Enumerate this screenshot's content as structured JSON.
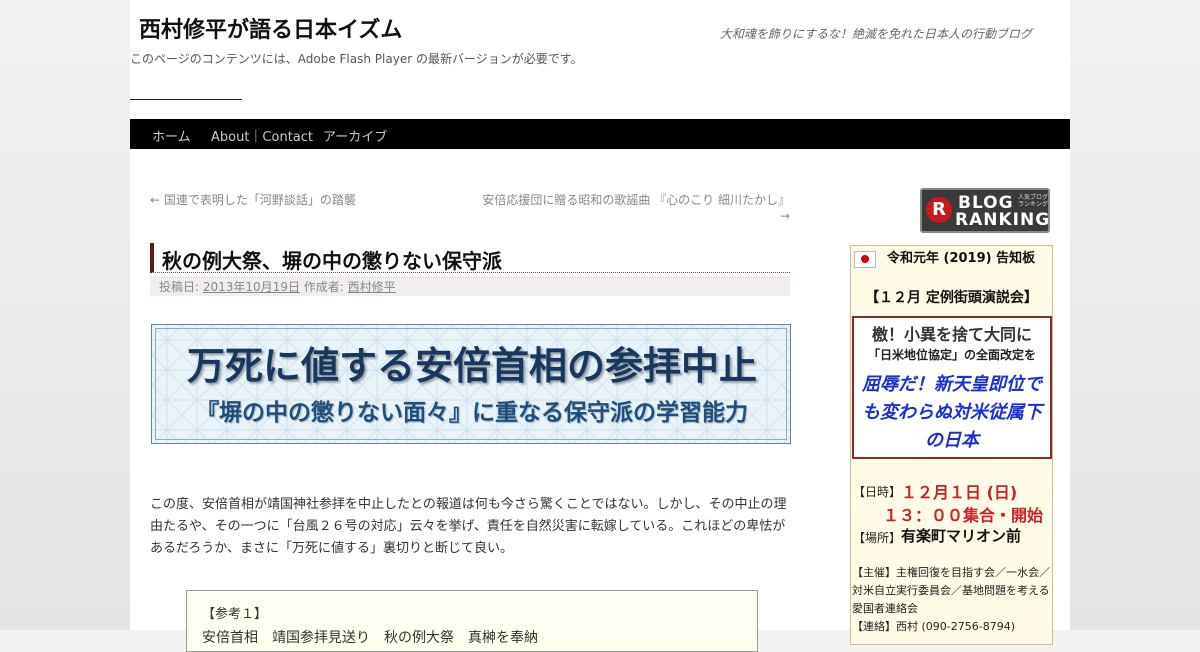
{
  "site": {
    "title": "西村修平が語る日本イズム",
    "description": "大和魂を飾りにするな！絶滅を免れた日本人の行動ブログ",
    "flash_message": "このページのコンテンツには、Adobe Flash Player の最新バージョンが必要です。"
  },
  "nav": {
    "items": [
      "ホーム",
      "About｜Contact",
      "アーカイブ"
    ]
  },
  "post_nav": {
    "prev": "← 国連で表明した「河野談話」の踏襲",
    "next_line1": "安倍応援団に贈る昭和の歌謡曲 『心のこり 細川たかし』",
    "next_line2": "→"
  },
  "post": {
    "title": "秋の例大祭、塀の中の懲りない保守派",
    "meta_posted_label": "投稿日:",
    "meta_date": "2013年10月19日",
    "meta_author_label": "作成者:",
    "meta_author": "西村修平",
    "banner_line1": "万死に値する安倍首相の参拝中止",
    "banner_line2": "『塀の中の懲りない面々』に重なる保守派の学習能力",
    "body": "この度、安倍首相が靖国神社参拝を中止したとの報道は何も今さら驚くことではない。しかし、その中止の理由たるや、その一つに「台風２６号の対応」云々を挙げ、責任を自然災害に転嫁している。これほどの卑怯があるだろうか、まさに「万死に値する」裏切りと断じて良い。",
    "reference_title": "【参考１】",
    "reference_cut": "安倍首相　靖国参拝見送り　秋の例大祭　真榊を奉納"
  },
  "sidebar": {
    "ranking_badge": {
      "circle": "R",
      "blog": "BLOG",
      "ranking": "RANKING",
      "small": "人気ブログランキング"
    },
    "notice": {
      "heading": "令和元年 (2019) 告知板",
      "title": "【１２月 定例街頭演説会】",
      "appeal_line1": "檄！小異を捨て大同に",
      "appeal_line2": "「日米地位協定」の全面改定を",
      "appeal_line3": "屈辱だ！新天皇即位でも変わらぬ対米従属下の日本",
      "date_label": "【日時】",
      "date": "１２月１日 (日)",
      "time": "１３：００集合・開始",
      "place_label": "【場所】",
      "place": "有楽町マリオン前",
      "host": "【主催】主権回復を目指す会／一水会／対米自立実行委員会／基地問題を考える愛国者連絡会",
      "contact": "【連絡】西村 (090-2756-8794)"
    }
  },
  "colors": {
    "nav_background": "#000000",
    "title_accent": "#5a1a1a",
    "banner_text": "#17375f",
    "notice_red": "#c82222",
    "notice_blue": "#1a2fd6"
  }
}
